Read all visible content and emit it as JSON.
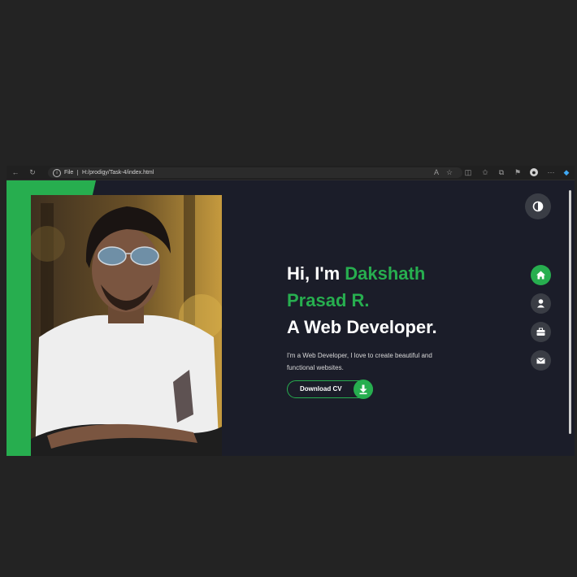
{
  "browser": {
    "address_scheme": "File",
    "address_url": "H:/prodigy/Task-4/index.html"
  },
  "hero": {
    "greeting": "Hi, I'm ",
    "name_first": "Dakshath",
    "name_last": "Prasad R.",
    "role": "A Web Developer.",
    "description_line1": "I'm a Web Developer, I love to create beautiful and",
    "description_line2": "functional websites.",
    "cta_label": "Download CV"
  },
  "nav": {
    "items": [
      "home-icon",
      "user-icon",
      "briefcase-icon",
      "envelope-icon"
    ],
    "active": "home-icon"
  },
  "colors": {
    "accent": "#27ae4f",
    "page_bg": "#1b1d29",
    "nav_inactive": "#3a3d45"
  }
}
